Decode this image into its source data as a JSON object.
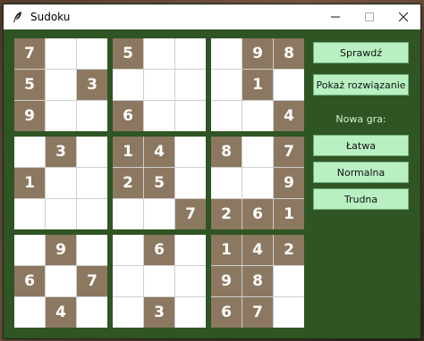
{
  "window": {
    "title": "Sudoku",
    "icon": "feather-icon",
    "controls": {
      "minimize": "—",
      "maximize": "☐",
      "close": "✕"
    }
  },
  "board": {
    "blocks": [
      [
        "7",
        "",
        "",
        "5",
        "",
        "3",
        "9",
        "",
        ""
      ],
      [
        "5",
        "",
        "",
        "",
        "",
        "",
        "6",
        "",
        ""
      ],
      [
        "",
        "9",
        "8",
        "",
        "1",
        "",
        "",
        "",
        "4"
      ],
      [
        "",
        "3",
        "",
        "1",
        "",
        "",
        "",
        "",
        ""
      ],
      [
        "1",
        "4",
        "",
        "2",
        "5",
        "",
        "",
        "",
        "7"
      ],
      [
        "8",
        "",
        "7",
        "",
        "",
        "9",
        "2",
        "6",
        "1"
      ],
      [
        "",
        "9",
        "",
        "6",
        "",
        "7",
        "",
        "4",
        ""
      ],
      [
        "",
        "6",
        "",
        "",
        "",
        "",
        "",
        "3",
        ""
      ],
      [
        "1",
        "4",
        "2",
        "9",
        "8",
        "",
        "6",
        "7",
        ""
      ]
    ]
  },
  "sidebar": {
    "check_label": "Sprawdź",
    "show_solution_label": "Pokaż rozwiązanie",
    "new_game_label": "Nowa gra:",
    "easy_label": "Łatwa",
    "normal_label": "Normalna",
    "hard_label": "Trudna"
  },
  "colors": {
    "background": "#2f5524",
    "given_cell": "#8c7860",
    "empty_cell": "#ffffff",
    "button": "#b9f0c2"
  }
}
